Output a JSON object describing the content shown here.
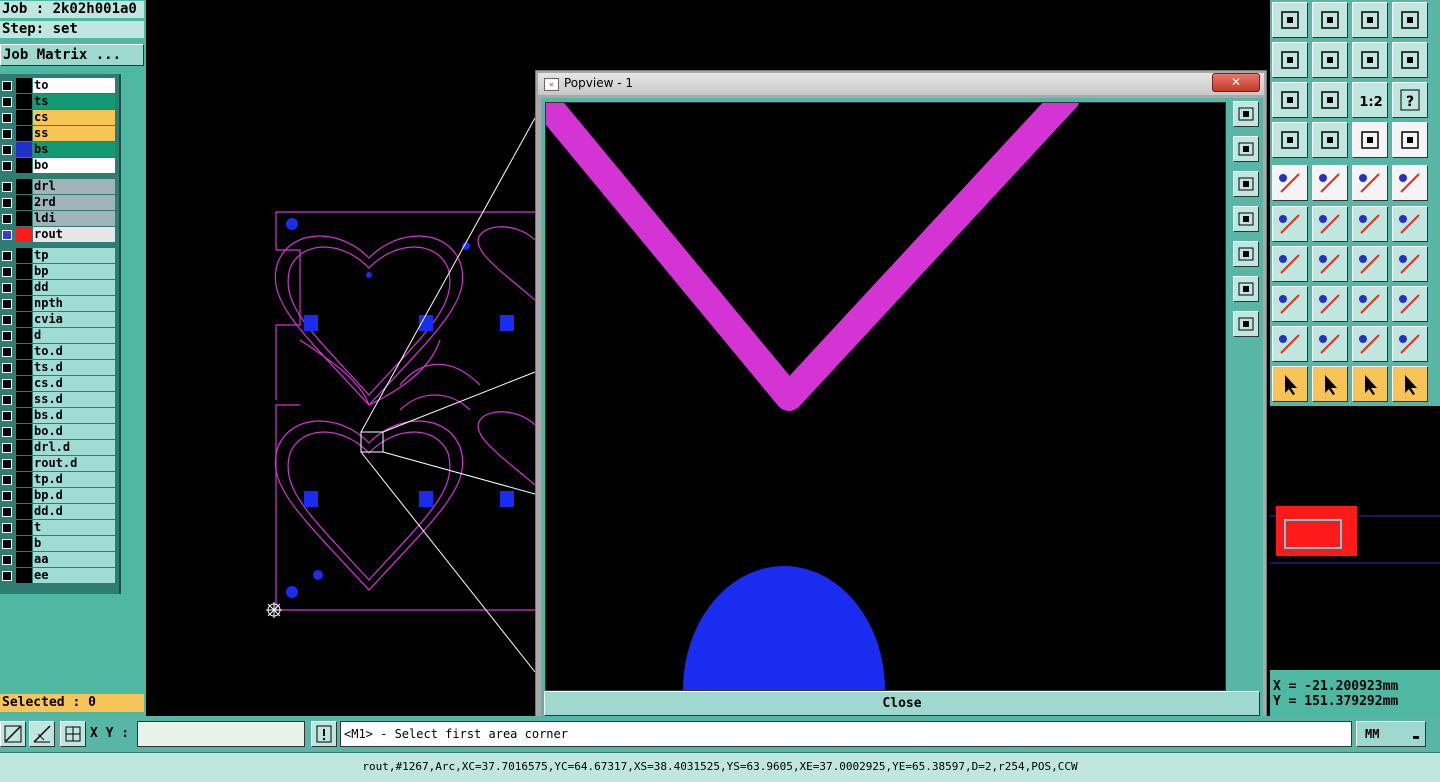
{
  "job": {
    "job_label": "Job : 2k02h001a0",
    "step_label": "Step: set",
    "matrix_button": "Job Matrix ..."
  },
  "layers": [
    {
      "name": "to",
      "color": "#ffffff",
      "active": false
    },
    {
      "name": "ts",
      "color": "#139a74",
      "active": false
    },
    {
      "name": "cs",
      "color": "#f7c456",
      "active": false
    },
    {
      "name": "ss",
      "color": "#f7c456",
      "active": false
    },
    {
      "name": "bs",
      "color": "#139a74",
      "active": true
    },
    {
      "name": "bo",
      "color": "#ffffff",
      "active": false
    },
    {
      "name": "drl",
      "color": "#9fb3b8",
      "active": false
    },
    {
      "name": "2rd",
      "color": "#9fb3b8",
      "active": false
    },
    {
      "name": "ldi",
      "color": "#9fb3b8",
      "active": false
    },
    {
      "name": "rout",
      "color": "#e6e6e6",
      "active": true
    },
    {
      "name": "tp",
      "color": "#9fdcd4",
      "active": false
    },
    {
      "name": "bp",
      "color": "#9fdcd4",
      "active": false
    },
    {
      "name": "dd",
      "color": "#9fdcd4",
      "active": false
    },
    {
      "name": "npth",
      "color": "#9fdcd4",
      "active": false
    },
    {
      "name": "cvia",
      "color": "#9fdcd4",
      "active": false
    },
    {
      "name": "d",
      "color": "#9fdcd4",
      "active": false
    },
    {
      "name": "to.d",
      "color": "#9fdcd4",
      "active": false
    },
    {
      "name": "ts.d",
      "color": "#9fdcd4",
      "active": false
    },
    {
      "name": "cs.d",
      "color": "#9fdcd4",
      "active": false
    },
    {
      "name": "ss.d",
      "color": "#9fdcd4",
      "active": false
    },
    {
      "name": "bs.d",
      "color": "#9fdcd4",
      "active": false
    },
    {
      "name": "bo.d",
      "color": "#9fdcd4",
      "active": false
    },
    {
      "name": "drl.d",
      "color": "#9fdcd4",
      "active": false
    },
    {
      "name": "rout.d",
      "color": "#9fdcd4",
      "active": false
    },
    {
      "name": "tp.d",
      "color": "#9fdcd4",
      "active": false
    },
    {
      "name": "bp.d",
      "color": "#9fdcd4",
      "active": false
    },
    {
      "name": "dd.d",
      "color": "#9fdcd4",
      "active": false
    },
    {
      "name": "t",
      "color": "#9fdcd4",
      "active": false
    },
    {
      "name": "b",
      "color": "#9fdcd4",
      "active": false
    },
    {
      "name": "aa",
      "color": "#9fdcd4",
      "active": false
    },
    {
      "name": "ee",
      "color": "#9fdcd4",
      "active": false
    }
  ],
  "selected_label": "Selected : 0",
  "popview": {
    "title": "Popview - 1",
    "close_label": "Close",
    "title_close_glyph": "✕"
  },
  "coords": {
    "x": "X = -21.200923mm",
    "y": "Y = 151.379292mm"
  },
  "bottom": {
    "xy_label": "X Y :",
    "xy_value": "",
    "prompt": "<M1> - Select first area corner",
    "units": "MM",
    "units_arrow": "▬"
  },
  "status_line": "rout,#1267,Arc,XC=37.7016575,YC=64.67317,XS=38.4031525,YS=63.9605,XE=37.0002925,YE=65.38597,D=2,r254,POS,CCW",
  "toolbar_text": {
    "ratio": "1:2",
    "help": "?"
  },
  "colors": {
    "panel": "#4fb8a3",
    "rout": "#d534d5",
    "pad": "#1a2cf0",
    "tool_yellow": "#f8c458"
  }
}
